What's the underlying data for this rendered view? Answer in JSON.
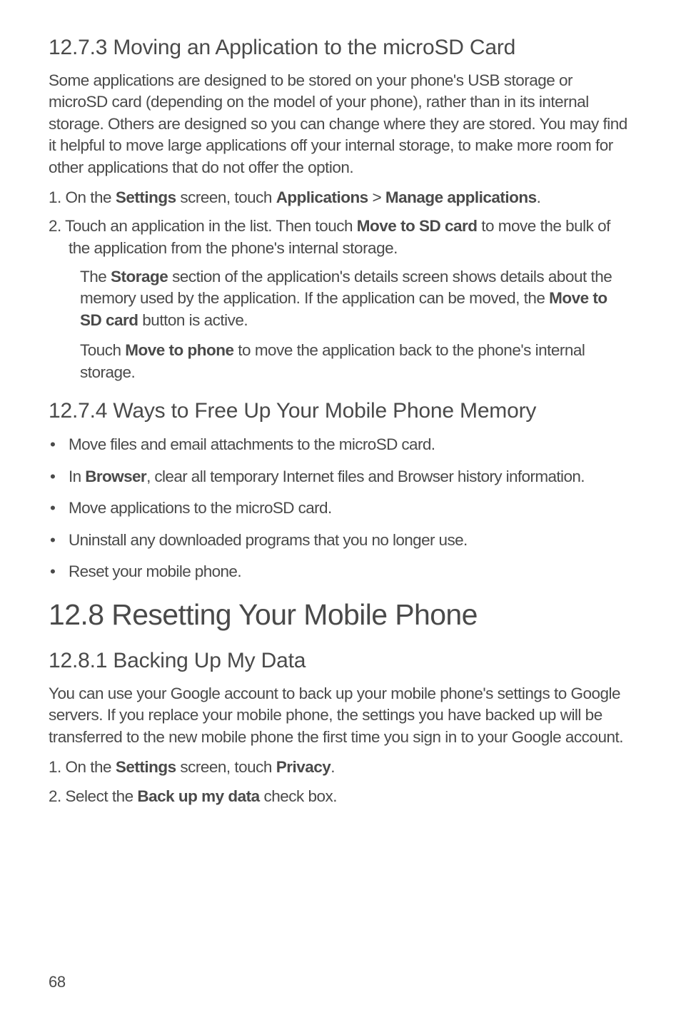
{
  "sections": {
    "s1": {
      "heading": "12.7.3  Moving an Application to the microSD Card",
      "para1": "Some applications are designed to be stored on your phone's USB storage or microSD card (depending on the model of your phone), rather than in its internal storage. Others are designed so you can change where they are stored. You may find it helpful to move large applications off your internal storage, to make more room for other applications that do not offer the option.",
      "step1_num": "1. ",
      "step1_a": "On the ",
      "step1_b": "Settings",
      "step1_c": " screen, touch ",
      "step1_d": "Applications",
      "step1_e": " > ",
      "step1_f": "Manage applications",
      "step1_g": ".",
      "step2_num": "2. ",
      "step2_a": "Touch an application in the list. Then touch ",
      "step2_b": "Move to SD card",
      "step2_c": " to move the bulk of the application from the phone's internal storage.",
      "note1_a": "The ",
      "note1_b": "Storage",
      "note1_c": " section of the application's details screen shows details about the memory used by the application. If the application can be moved, the ",
      "note1_d": "Move to SD card",
      "note1_e": " button is active.",
      "note2_a": "Touch ",
      "note2_b": "Move to phone",
      "note2_c": " to move the application back to the phone's internal storage."
    },
    "s2": {
      "heading": "12.7.4  Ways to Free Up Your Mobile Phone Memory",
      "b1": "Move files and email attachments to the microSD card.",
      "b2_a": "In ",
      "b2_b": "Browser",
      "b2_c": ", clear all temporary Internet files and Browser history information.",
      "b3": "Move applications to the microSD card.",
      "b4": "Uninstall any downloaded programs that you no longer use.",
      "b5": "Reset your mobile phone."
    },
    "s3": {
      "heading": "12.8  Resetting Your Mobile Phone"
    },
    "s4": {
      "heading": "12.8.1  Backing Up My Data",
      "para1": "You can use your Google account to back up your mobile phone's settings to Google servers. If you replace your mobile phone, the settings you have backed up will be transferred to the new mobile phone the first time you sign in to your Google account.",
      "step1_num": "1. ",
      "step1_a": "On the ",
      "step1_b": "Settings",
      "step1_c": " screen, touch ",
      "step1_d": "Privacy",
      "step1_e": ".",
      "step2_num": "2. ",
      "step2_a": "Select the ",
      "step2_b": "Back up my data",
      "step2_c": " check box."
    }
  },
  "page_number": "68"
}
